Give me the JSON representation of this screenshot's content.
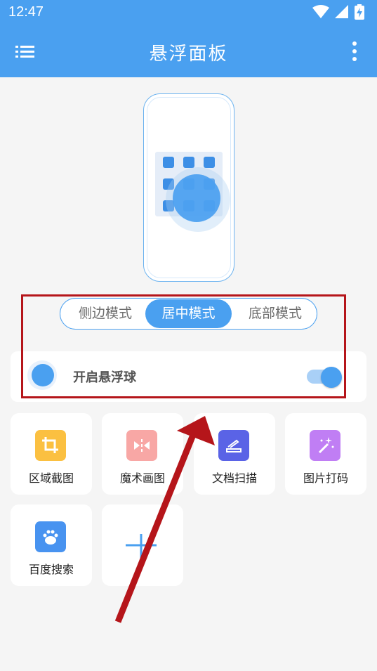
{
  "status_bar": {
    "time": "12:47"
  },
  "app_bar": {
    "title": "悬浮面板"
  },
  "mode_selector": {
    "options": [
      "侧边模式",
      "居中模式",
      "底部模式"
    ],
    "selected": "居中模式"
  },
  "float_ball_toggle": {
    "label": "开启悬浮球",
    "enabled": true
  },
  "tools": [
    {
      "label": "区域截图",
      "color": "#fbc041",
      "icon": "crop-icon"
    },
    {
      "label": "魔术画图",
      "color": "#f8a7a5",
      "icon": "magic-draw-icon"
    },
    {
      "label": "文档扫描",
      "color": "#5a63e6",
      "icon": "scanner-icon"
    },
    {
      "label": "图片打码",
      "color": "#c07ef4",
      "icon": "magic-wand-icon"
    },
    {
      "label": "百度搜索",
      "color": "#4893f0",
      "icon": "baidu-paw-icon"
    }
  ],
  "add_tile": {
    "icon": "plus-icon"
  },
  "accent_color": "#4aa0f0",
  "annotation_color": "#b5151a"
}
